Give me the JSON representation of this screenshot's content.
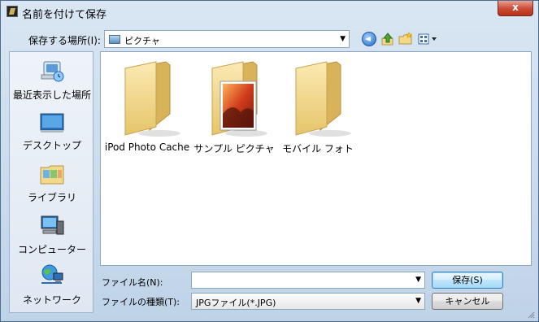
{
  "window": {
    "title": "名前を付けて保存",
    "close_glyph": "x"
  },
  "location": {
    "label": "保存する場所(I):",
    "value": "ピクチャ"
  },
  "toolbar": {
    "icons": [
      "back-icon",
      "up-folder-icon",
      "new-folder-icon",
      "views-icon"
    ]
  },
  "places": [
    {
      "label": "最近表示した場所",
      "icon": "recent-places-icon"
    },
    {
      "label": "デスクトップ",
      "icon": "desktop-icon"
    },
    {
      "label": "ライブラリ",
      "icon": "libraries-icon"
    },
    {
      "label": "コンピューター",
      "icon": "computer-icon"
    },
    {
      "label": "ネットワーク",
      "icon": "network-icon"
    }
  ],
  "files": [
    {
      "name": "iPod Photo Cache",
      "icon": "folder-icon"
    },
    {
      "name": "サンプル ピクチャ",
      "icon": "folder-with-photo-icon"
    },
    {
      "name": "モバイル フォト",
      "icon": "folder-icon"
    }
  ],
  "form": {
    "filename_label": "ファイル名(N):",
    "filename_value": "",
    "filetype_label": "ファイルの種類(T):",
    "filetype_value": "JPGファイル(*.JPG)"
  },
  "buttons": {
    "save": "保存(S)",
    "cancel": "キャンセル"
  },
  "colors": {
    "folder": "#f3d98a",
    "close": "#c94a33",
    "primary_border": "#3c7fb1"
  }
}
